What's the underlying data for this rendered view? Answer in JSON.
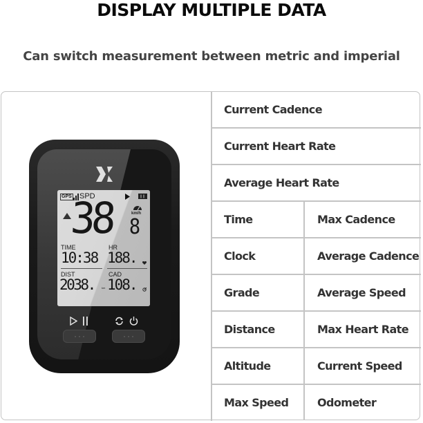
{
  "header": {
    "title": "DISPLAY MULTIPLE DATA",
    "subtitle": "Can switch measurement between metric and imperial"
  },
  "device": {
    "brand_logo_icon": "x-logo-icon",
    "screen": {
      "status": {
        "gps_label": "GPS",
        "signal_icon": "signal-bars-icon",
        "mode_label": "SPD",
        "play_icon": "play-triangle-icon",
        "battery_icon": "battery-icon"
      },
      "speed": {
        "trend_icon": "up-triangle-icon",
        "value_main": "38",
        "value_decimal": "8",
        "gauge_icon": "speedometer-icon",
        "unit": "km/h"
      },
      "fields": [
        {
          "label": "TIME",
          "value": "10:38",
          "unit_icon": ""
        },
        {
          "label": "HR",
          "value": "188.",
          "unit_icon": "heart-icon"
        },
        {
          "label": "DIST",
          "value": "2038.",
          "unit": "km"
        },
        {
          "label": "CAD",
          "value": "108.",
          "unit_icon": "crank-icon"
        }
      ]
    },
    "buttons": [
      {
        "icons": [
          "play-outline-icon",
          "pause-icon"
        ],
        "label": "start-pause"
      },
      {
        "icons": [
          "refresh-icon",
          "power-icon"
        ],
        "label": "switch-power"
      }
    ]
  },
  "data_table": {
    "full_rows": [
      "Current Cadence",
      "Current Heart Rate",
      "Average Heart Rate"
    ],
    "split_rows": [
      {
        "left": "Time",
        "right": "Max Cadence"
      },
      {
        "left": "Clock",
        "right": "Average Cadence"
      },
      {
        "left": "Grade",
        "right": "Average Speed"
      },
      {
        "left": "Distance",
        "right": "Max Heart Rate"
      },
      {
        "left": "Altitude",
        "right": "Current Speed"
      },
      {
        "left": "Max Speed",
        "right": "Odometer"
      }
    ]
  }
}
